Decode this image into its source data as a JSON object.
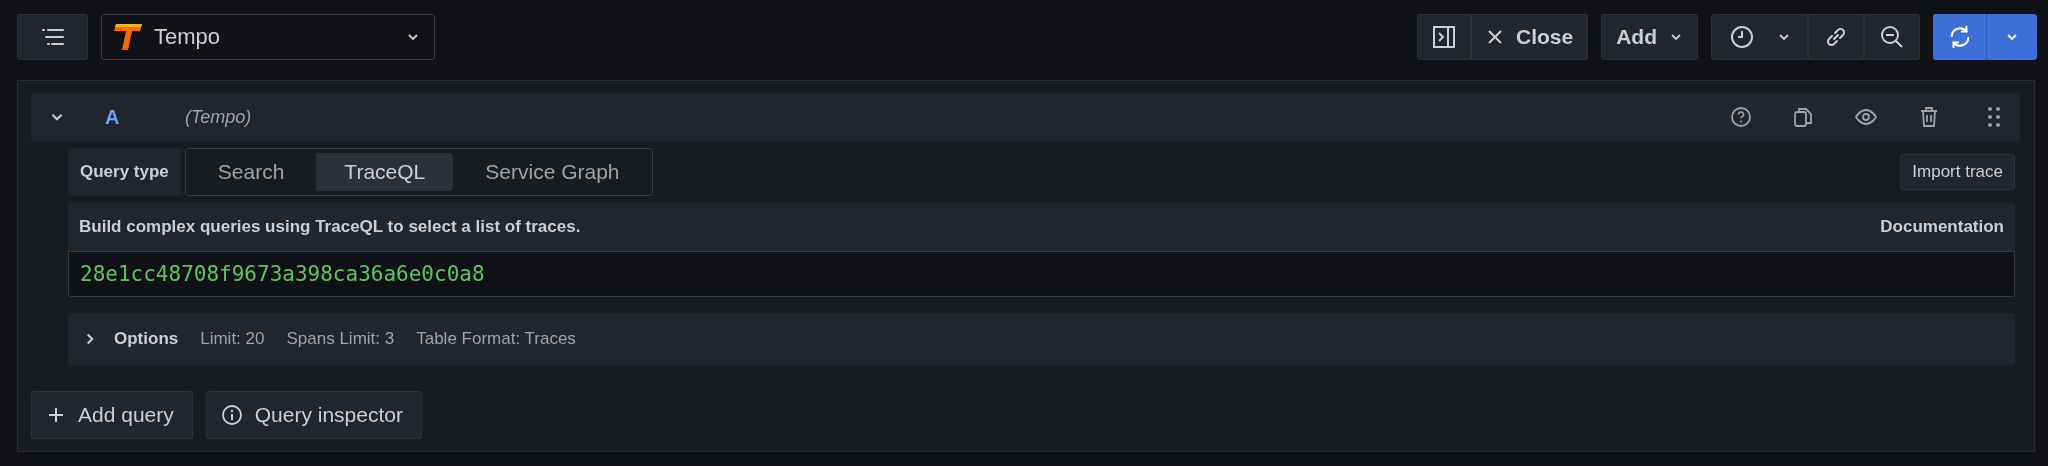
{
  "toolbar": {
    "datasource": "Tempo",
    "close_label": "Close",
    "add_label": "Add"
  },
  "query": {
    "expanded": true,
    "ref": "A",
    "datasource": "(Tempo)",
    "query_type_label": "Query type",
    "query_types": [
      {
        "label": "Search",
        "selected": false
      },
      {
        "label": "TraceQL",
        "selected": true
      },
      {
        "label": "Service Graph",
        "selected": false
      }
    ],
    "import_button": "Import trace",
    "description": "Build complex queries using TraceQL to select a list of traces.",
    "documentation_link": "Documentation",
    "value": "28e1cc48708f9673a398ca36a6e0c0a8",
    "options": {
      "expanded": false,
      "label": "Options",
      "summary": [
        "Limit: 20",
        "Spans Limit: 3",
        "Table Format: Traces"
      ]
    }
  },
  "actions": [
    {
      "kind": "add",
      "label": "Add query"
    },
    {
      "kind": "info",
      "label": "Query inspector"
    }
  ]
}
